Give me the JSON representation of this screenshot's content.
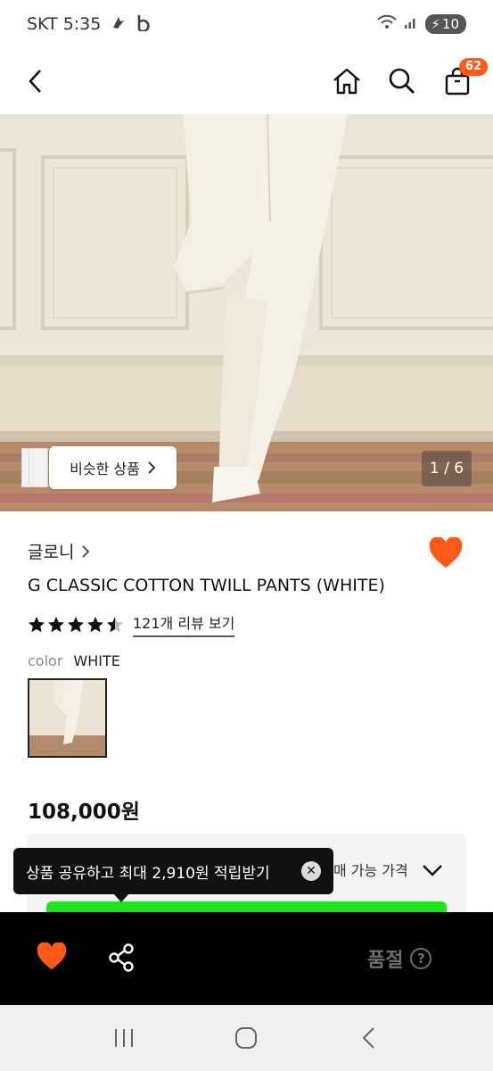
{
  "status_bar": {
    "carrier_time": "SKT 5:35",
    "battery_level": "10"
  },
  "header": {
    "cart_count": "62"
  },
  "gallery": {
    "similar_label": "비슷한 상품",
    "page_indicator": "1 / 6"
  },
  "product": {
    "brand": "글로니",
    "name": "G CLASSIC COTTON TWILL PANTS (WHITE)",
    "rating": 4.5,
    "review_link": "121개 리뷰 보기",
    "color_label": "color",
    "color_value": "WHITE",
    "price": "108,000원"
  },
  "price_box": {
    "label": "매 가능 가격"
  },
  "tooltip": {
    "text": "상품 공유하고 최대 2,910원 적립받기"
  },
  "action_bar": {
    "soldout_label": "품절"
  },
  "colors": {
    "accent": "#ff5a1a",
    "green": "#22e322"
  }
}
